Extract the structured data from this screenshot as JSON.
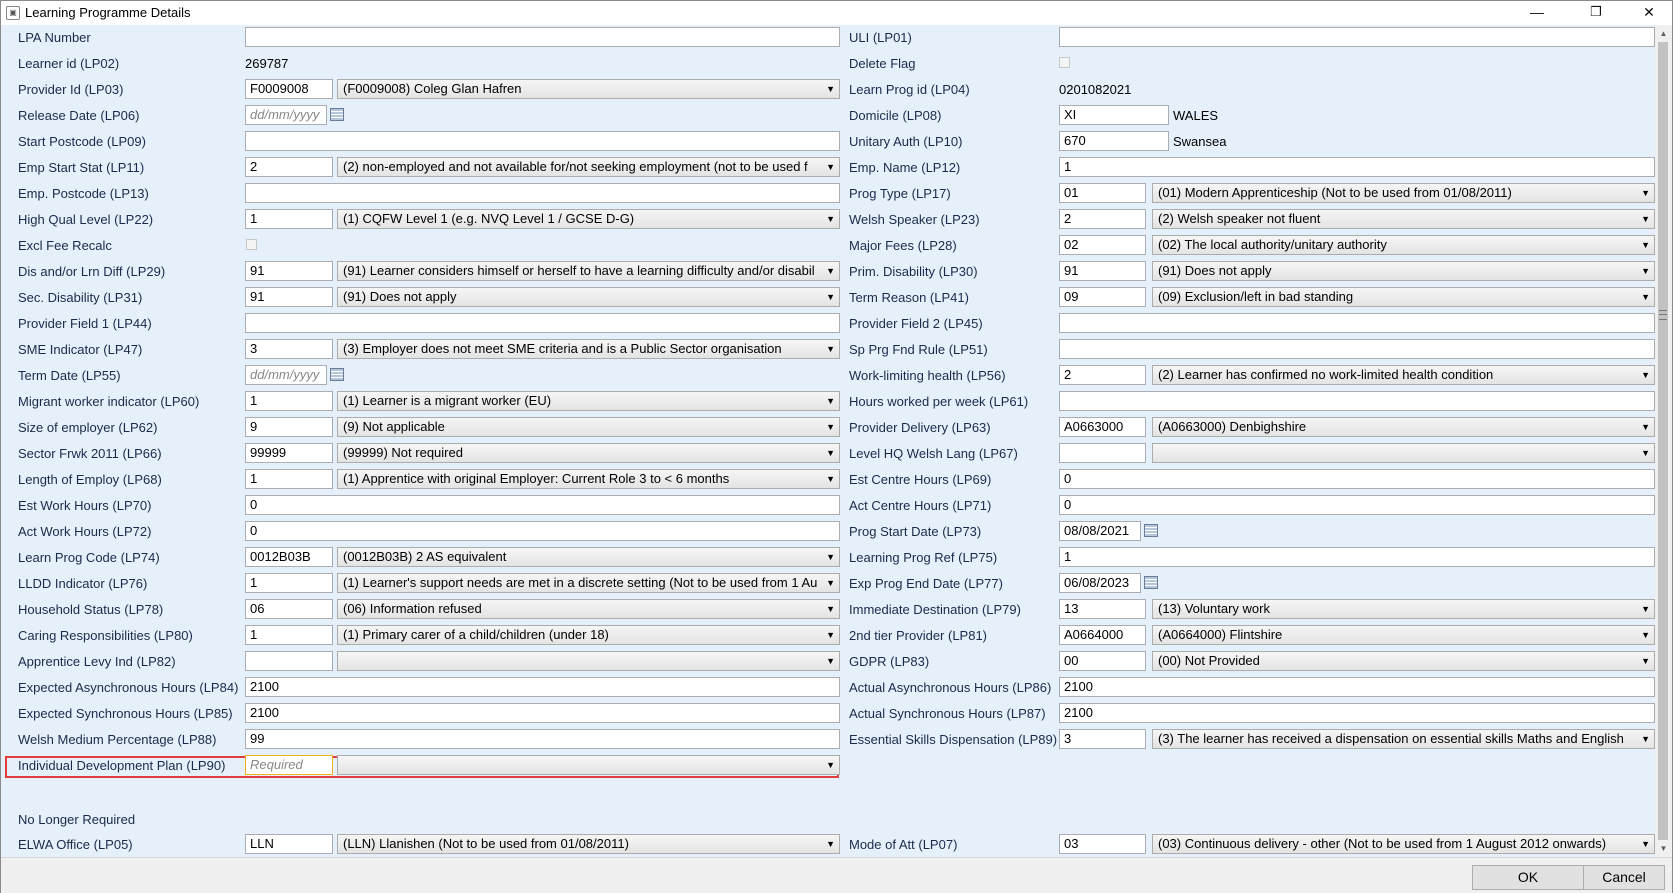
{
  "window": {
    "title": "Learning Programme Details",
    "minimize": "—",
    "restore": "❐",
    "close": "✕"
  },
  "fields": {
    "lpa_label": "LPA Number",
    "lpa_value": "",
    "uli_label": "ULI (LP01)",
    "uli_value": "",
    "learner_id_label": "Learner id (LP02)",
    "learner_id_value": "269787",
    "delete_flag_label": "Delete Flag",
    "provider_id_label": "Provider Id (LP03)",
    "provider_id_code": "F0009008",
    "provider_id_desc": "(F0009008) Coleg Glan Hafren",
    "learn_prog_id_label": "Learn Prog id (LP04)",
    "learn_prog_id_value": "0201082021",
    "release_date_label": "Release Date (LP06)",
    "release_date_placeholder": "dd/mm/yyyy",
    "domicile_label": "Domicile (LP08)",
    "domicile_code": "XI",
    "domicile_text": "WALES",
    "start_postcode_label": "Start Postcode (LP09)",
    "start_postcode_value": "",
    "unitary_auth_label": "Unitary Auth (LP10)",
    "unitary_auth_code": "670",
    "unitary_auth_text": "Swansea",
    "emp_start_stat_label": "Emp Start Stat (LP11)",
    "emp_start_stat_code": "2",
    "emp_start_stat_desc": "(2) non-employed and not available for/not seeking employment (not to be used f",
    "emp_name_label": "Emp. Name (LP12)",
    "emp_name_value": "1",
    "emp_postcode_label": "Emp. Postcode (LP13)",
    "emp_postcode_value": "",
    "prog_type_label": "Prog Type (LP17)",
    "prog_type_code": "01",
    "prog_type_desc": "(01) Modern Apprenticeship (Not to be used from 01/08/2011)",
    "high_qual_label": "High Qual Level (LP22)",
    "high_qual_code": "1",
    "high_qual_desc": "(1) CQFW Level 1 (e.g. NVQ Level 1 / GCSE D-G)",
    "welsh_speaker_label": "Welsh Speaker (LP23)",
    "welsh_speaker_code": "2",
    "welsh_speaker_desc": "(2) Welsh speaker not fluent",
    "excl_fee_label": "Excl Fee Recalc",
    "major_fees_label": "Major Fees (LP28)",
    "major_fees_code": "02",
    "major_fees_desc": "(02) The local authority/unitary authority",
    "dis_lrn_label": "Dis and/or Lrn Diff (LP29)",
    "dis_lrn_code": "91",
    "dis_lrn_desc": "(91) Learner considers himself or herself to have a learning difficulty and/or disabil",
    "prim_dis_label": "Prim. Disability (LP30)",
    "prim_dis_code": "91",
    "prim_dis_desc": "(91) Does not apply",
    "sec_dis_label": "Sec. Disability (LP31)",
    "sec_dis_code": "91",
    "sec_dis_desc": "(91) Does not apply",
    "term_reason_label": "Term Reason (LP41)",
    "term_reason_code": "09",
    "term_reason_desc": "(09) Exclusion/left in bad standing",
    "prov_field1_label": "Provider Field 1 (LP44)",
    "prov_field1_value": "",
    "prov_field2_label": "Provider Field 2 (LP45)",
    "prov_field2_value": "",
    "sme_label": "SME Indicator (LP47)",
    "sme_code": "3",
    "sme_desc": "(3) Employer does not meet SME criteria and is a Public Sector organisation",
    "sp_prg_label": "Sp Prg Fnd Rule (LP51)",
    "sp_prg_value": "",
    "term_date_label": "Term Date (LP55)",
    "term_date_placeholder": "dd/mm/yyyy",
    "work_lim_label": "Work-limiting health (LP56)",
    "work_lim_code": "2",
    "work_lim_desc": "(2) Learner has confirmed no work-limited health condition",
    "migrant_label": "Migrant worker indicator (LP60)",
    "migrant_code": "1",
    "migrant_desc": "(1) Learner is a migrant worker (EU)",
    "hours_worked_label": "Hours worked per week (LP61)",
    "hours_worked_value": "",
    "size_emp_label": "Size of employer (LP62)",
    "size_emp_code": "9",
    "size_emp_desc": "(9) Not applicable",
    "prov_delivery_label": "Provider Delivery (LP63)",
    "prov_delivery_code": "A0663000",
    "prov_delivery_desc": "(A0663000) Denbighshire",
    "sector_label": "Sector Frwk 2011 (LP66)",
    "sector_code": "99999",
    "sector_desc": "(99999) Not required",
    "level_hq_label": "Level HQ Welsh Lang (LP67)",
    "level_hq_code": "",
    "level_hq_desc": "",
    "length_emp_label": "Length of Employ (LP68)",
    "length_emp_code": "1",
    "length_emp_desc": "(1) Apprentice with original Employer: Current Role 3 to < 6 months",
    "est_centre_label": "Est Centre Hours (LP69)",
    "est_centre_value": "0",
    "est_work_label": "Est Work Hours (LP70)",
    "est_work_value": "0",
    "act_centre_label": "Act Centre Hours (LP71)",
    "act_centre_value": "0",
    "act_work_label": "Act Work Hours (LP72)",
    "act_work_value": "0",
    "prog_start_label": "Prog Start Date (LP73)",
    "prog_start_value": "08/08/2021",
    "learn_prog_code_label": "Learn Prog Code (LP74)",
    "learn_prog_code_code": "0012B03B",
    "learn_prog_code_desc": "(0012B03B) 2 AS equivalent",
    "learning_ref_label": "Learning Prog Ref (LP75)",
    "learning_ref_value": "1",
    "lldd_label": "LLDD Indicator (LP76)",
    "lldd_code": "1",
    "lldd_desc": "(1) Learner's support needs are met in a discrete setting (Not to be used from 1 Au",
    "exp_end_label": "Exp Prog End Date (LP77)",
    "exp_end_value": "06/08/2023",
    "household_label": "Household Status (LP78)",
    "household_code": "06",
    "household_desc": "(06) Information refused",
    "imm_dest_label": "Immediate Destination (LP79)",
    "imm_dest_code": "13",
    "imm_dest_desc": "(13) Voluntary work",
    "caring_label": "Caring Responsibilities (LP80)",
    "caring_code": "1",
    "caring_desc": "(1) Primary carer of a child/children (under 18)",
    "tier2_label": "2nd tier Provider (LP81)",
    "tier2_code": "A0664000",
    "tier2_desc": "(A0664000) Flintshire",
    "levy_label": "Apprentice Levy Ind (LP82)",
    "levy_code": "",
    "levy_desc": "",
    "gdpr_label": "GDPR (LP83)",
    "gdpr_code": "00",
    "gdpr_desc": "(00) Not Provided",
    "exp_async_label": "Expected Asynchronous Hours (LP84)",
    "exp_async_value": "2100",
    "act_async_label": "Actual Asynchronous Hours (LP86)",
    "act_async_value": "2100",
    "exp_sync_label": "Expected Synchronous Hours (LP85)",
    "exp_sync_value": "2100",
    "act_sync_label": "Actual Synchronous Hours (LP87)",
    "act_sync_value": "2100",
    "welsh_pct_label": "Welsh Medium Percentage (LP88)",
    "welsh_pct_value": "99",
    "ess_skills_label": "Essential Skills Dispensation (LP89)",
    "ess_skills_code": "3",
    "ess_skills_desc": "(3) The learner has received a dispensation on essential skills Maths and English",
    "idp_label": "Individual Development Plan (LP90)",
    "idp_placeholder": "Required",
    "idp_desc": ""
  },
  "no_longer_required": {
    "heading": "No Longer Required",
    "elwa_label": "ELWA Office (LP05)",
    "elwa_code": "LLN",
    "elwa_desc": "(LLN) Llanishen (Not to be used from 01/08/2011)",
    "mode_att_label": "Mode of Att (LP07)",
    "mode_att_code": "03",
    "mode_att_desc": "(03) Continuous delivery - other (Not to be used from 1 August 2012 onwards)"
  },
  "footer": {
    "ok": "OK",
    "cancel": "Cancel"
  },
  "icons": {
    "calendar": "calendar-icon",
    "dropdown": "chevron-down-icon"
  },
  "colors": {
    "panel_bg": "#e6f0fb",
    "highlight_border": "#e03c3c",
    "label_text": "#1a2a4a"
  }
}
